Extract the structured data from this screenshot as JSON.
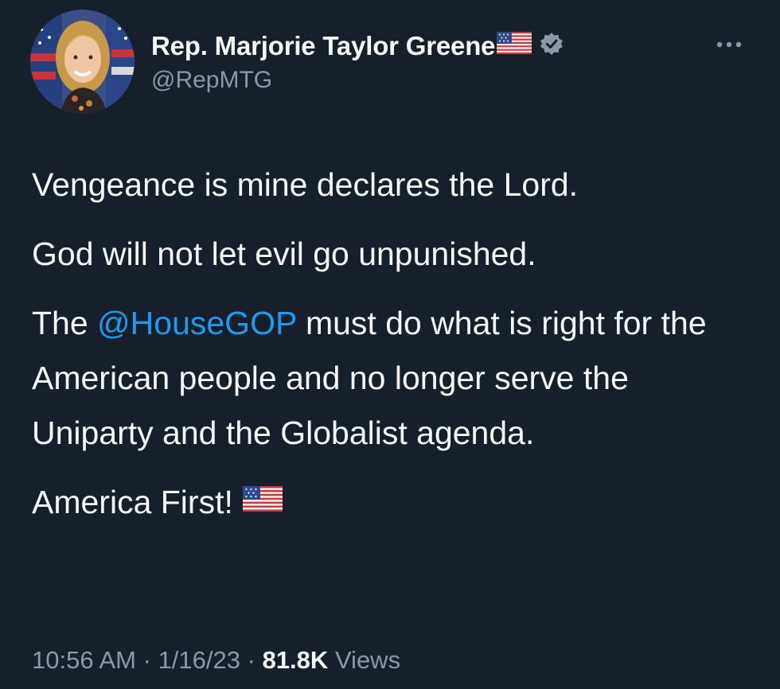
{
  "author": {
    "display_name": "Rep. Marjorie Taylor Greene",
    "name_emoji": "flag-usa-icon",
    "verified_icon": "verified-badge-icon",
    "handle": "@RepMTG"
  },
  "tweet": {
    "line1": "Vengeance is mine declares the Lord.",
    "line2": "God will not let evil go unpunished.",
    "para3_prefix": "The ",
    "mention": "@HouseGOP",
    "para3_suffix": " must do what is right for the American people and no longer serve the Uniparty and the Globalist agenda.",
    "line4": "America First!",
    "line4_emoji": "flag-usa-icon"
  },
  "meta": {
    "time": "10:56 AM",
    "separator": "·",
    "date": "1/16/23",
    "views_count": "81.8K",
    "views_label": "Views"
  },
  "colors": {
    "background": "#15202b",
    "text": "#f7f9f9",
    "secondary": "#8b98a5",
    "link": "#1d9bf0",
    "verified": "#8b98a5"
  }
}
